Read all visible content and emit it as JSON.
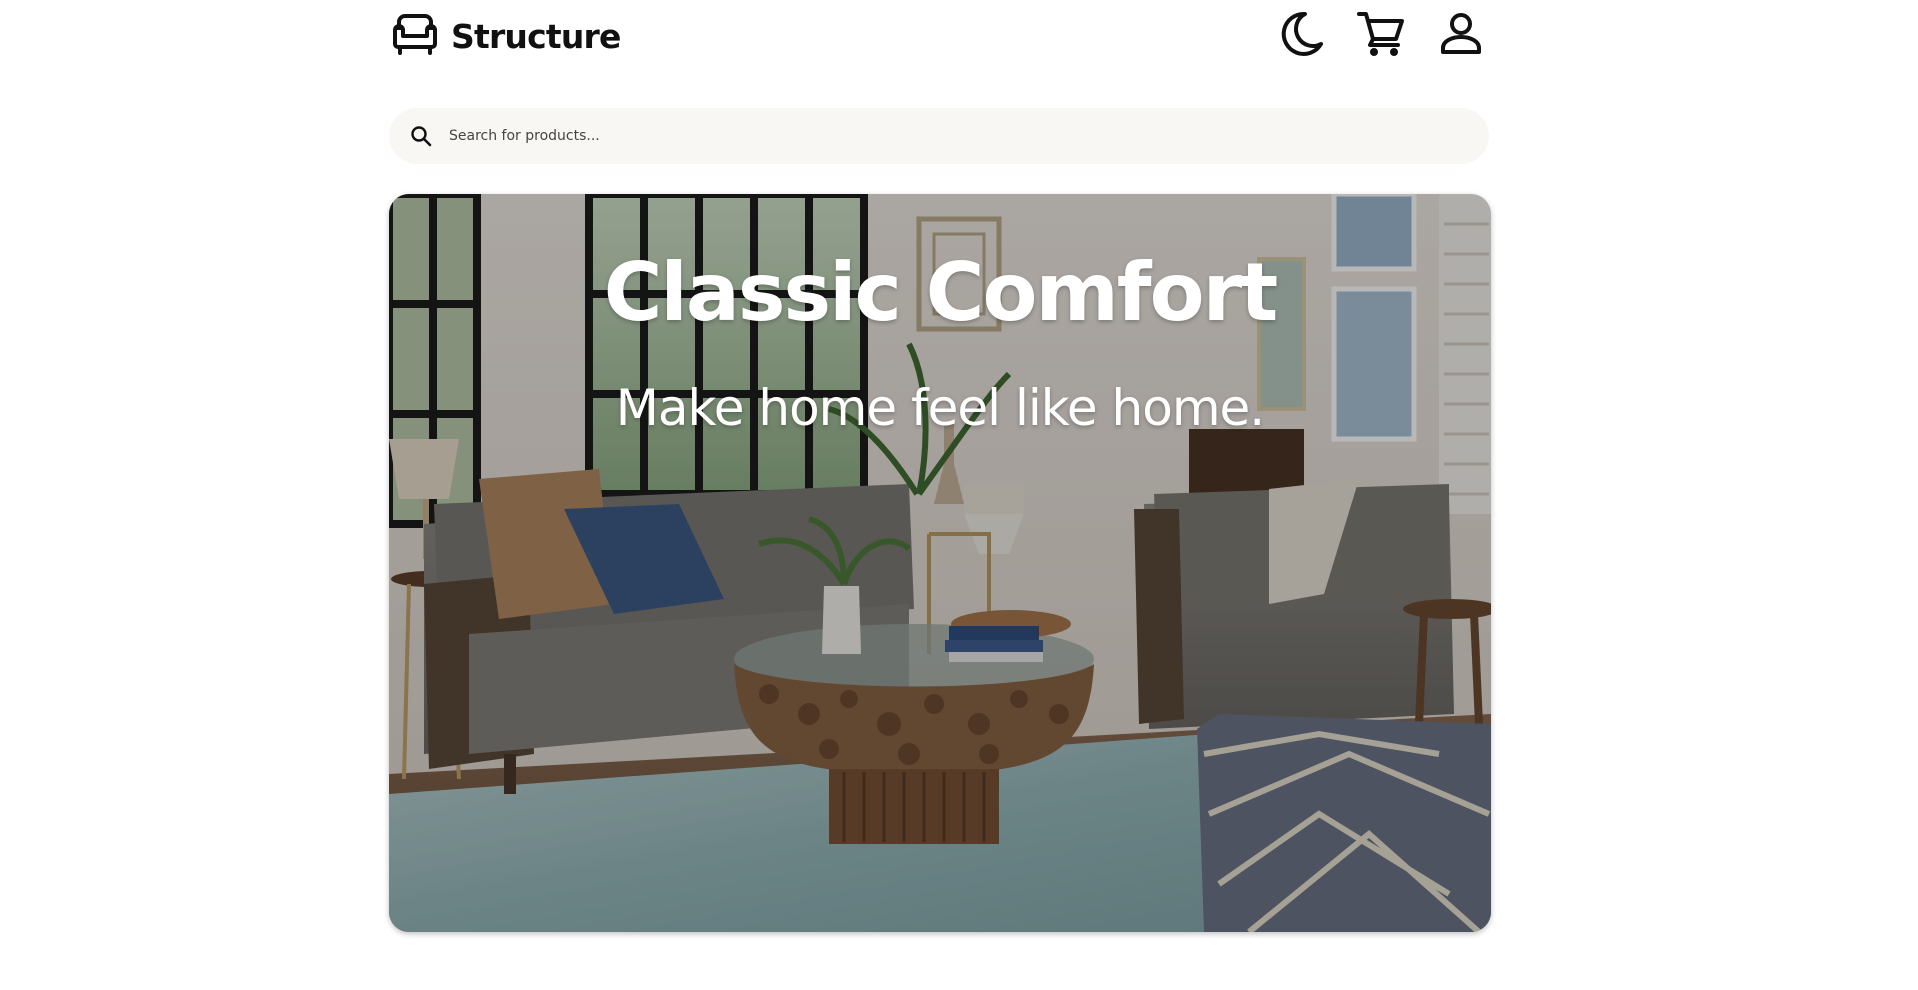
{
  "header": {
    "logo_text": "Structure",
    "logo_icon": "sofa-icon",
    "icons": [
      "moon-icon",
      "cart-icon",
      "user-icon"
    ]
  },
  "search": {
    "placeholder": "Search for products...",
    "value": ""
  },
  "hero": {
    "title": "Classic Comfort",
    "subtitle": "Make home feel like home."
  },
  "colors": {
    "background": "#ffffff",
    "search_bg": "#f8f7f4",
    "hero_text": "#ffffff"
  }
}
